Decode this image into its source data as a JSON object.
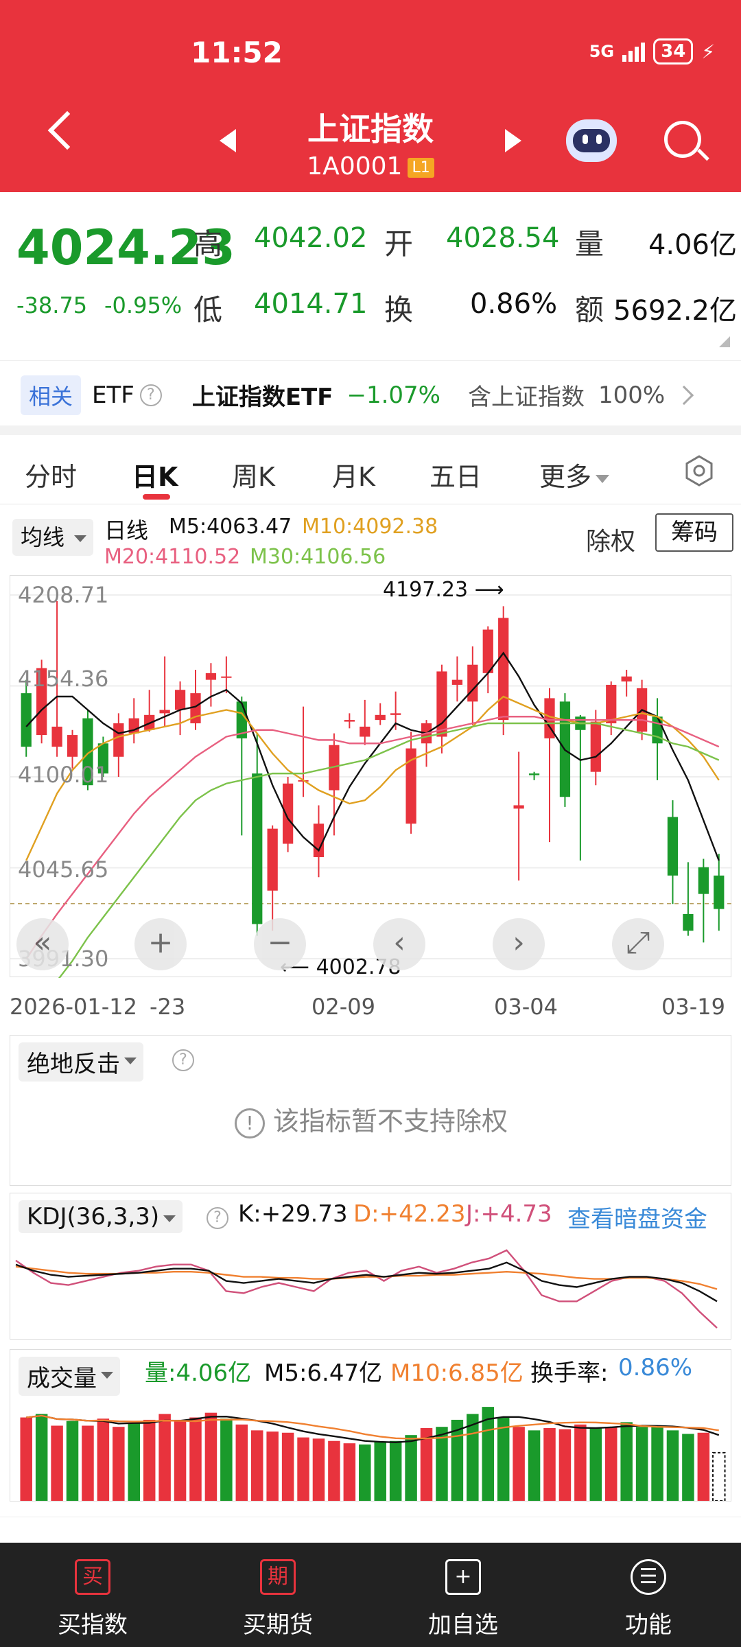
{
  "status": {
    "time": "11:52",
    "network": "5G",
    "battery": "34"
  },
  "header": {
    "title": "上证指数",
    "code": "1A0001",
    "badge": "L1"
  },
  "quote": {
    "price": "4024.23",
    "change": "-38.75",
    "change_pct": "-0.95%",
    "high_label": "高",
    "high": "4042.02",
    "open_label": "开",
    "open": "4028.54",
    "vol_label": "量",
    "vol": "4.06亿",
    "low_label": "低",
    "low": "4014.71",
    "turnover_label": "换",
    "turnover": "0.86%",
    "amount_label": "额",
    "amount": "5692.2亿"
  },
  "etf": {
    "tag": "相关",
    "word": "ETF",
    "name": "上证指数ETF",
    "change": "−1.07%",
    "contain": "含上证指数",
    "pct": "100%"
  },
  "tabs": [
    "分时",
    "日K",
    "周K",
    "月K",
    "五日",
    "更多"
  ],
  "ma": {
    "selector": "均线",
    "type": "日线",
    "m5": "M5:4063.47",
    "m10": "M10:4092.38",
    "m20": "M20:4110.52",
    "m30": "M30:4106.56",
    "chuquan": "除权",
    "chouma": "筹码"
  },
  "colors": {
    "up": "#e8333d",
    "down": "#1a9a2b",
    "m5": "#111111",
    "m10": "#e0a020",
    "m20": "#e86080",
    "m30": "#7cc24a",
    "accent": "#e8333d"
  },
  "chart_data": {
    "type": "candlestick",
    "y_ticks": [
      "4208.71",
      "4154.36",
      "4100.01",
      "4045.65",
      "3991.30"
    ],
    "ylim": [
      3991.3,
      4208.71
    ],
    "x_labels": [
      "2026-01-12",
      "-23",
      "02-09",
      "03-04",
      "03-19"
    ],
    "high_annotation": "4197.23",
    "low_annotation": "4002.78",
    "last_close": 4024.23,
    "candles": [
      [
        4150,
        4118,
        4158,
        4112
      ],
      [
        4125,
        4165,
        4170,
        4120
      ],
      [
        4118,
        4130,
        4205,
        4112
      ],
      [
        4112,
        4125,
        4128,
        4105
      ],
      [
        4135,
        4095,
        4140,
        4092
      ],
      [
        4120,
        4102,
        4124,
        4100
      ],
      [
        4112,
        4132,
        4138,
        4100
      ],
      [
        4126,
        4135,
        4147,
        4120
      ],
      [
        4128,
        4137,
        4152,
        4127
      ],
      [
        4138,
        4140,
        4172,
        4130
      ],
      [
        4140,
        4152,
        4157,
        4125
      ],
      [
        4132,
        4150,
        4164,
        4128
      ],
      [
        4158,
        4162,
        4168,
        4142
      ],
      [
        4160,
        4160,
        4172,
        4150
      ],
      [
        4145,
        4123,
        4148,
        4065
      ],
      [
        4102,
        4012,
        4126,
        4005
      ],
      [
        4032,
        4069,
        4071,
        4008
      ],
      [
        4060,
        4096,
        4100,
        4055
      ],
      [
        4098,
        4098,
        4142,
        4088
      ],
      [
        4052,
        4072,
        4083,
        4040
      ],
      [
        4092,
        4119,
        4126,
        4065
      ],
      [
        4133,
        4134,
        4138,
        4129
      ],
      [
        4124,
        4130,
        4146,
        4119
      ],
      [
        4134,
        4137,
        4144,
        4131
      ],
      [
        4137,
        4138,
        4151,
        4128
      ],
      [
        4072,
        4117,
        4127,
        4066
      ],
      [
        4120,
        4132,
        4134,
        4106
      ],
      [
        4124,
        4163,
        4167,
        4114
      ],
      [
        4155,
        4158,
        4172,
        4145
      ],
      [
        4145,
        4167,
        4178,
        4131
      ],
      [
        4162,
        4188,
        4190,
        4150
      ],
      [
        4134,
        4195,
        4202,
        4125
      ],
      [
        4081,
        4083,
        4115,
        4038
      ],
      [
        4102,
        4101,
        4103,
        4098
      ],
      [
        4123,
        4147,
        4153,
        4061
      ],
      [
        4145,
        4088,
        4150,
        4082
      ],
      [
        4136,
        4128,
        4137,
        4050
      ],
      [
        4103,
        4133,
        4140,
        4095
      ],
      [
        4132,
        4155,
        4157,
        4125
      ],
      [
        4157,
        4160,
        4164,
        4148
      ],
      [
        4127,
        4153,
        4158,
        4122
      ],
      [
        4136,
        4120,
        4147,
        4098
      ],
      [
        4076,
        4041,
        4086,
        4024
      ],
      [
        4018,
        4008,
        4049,
        4005
      ],
      [
        4046,
        4030,
        4051,
        4001
      ],
      [
        4041,
        4021,
        4054,
        4008
      ]
    ],
    "ma_lines": {
      "M5": [
        4130,
        4140,
        4148,
        4148,
        4140,
        4132,
        4126,
        4128,
        4132,
        4136,
        4140,
        4142,
        4148,
        4152,
        4144,
        4120,
        4095,
        4075,
        4064,
        4056,
        4076,
        4094,
        4108,
        4120,
        4132,
        4128,
        4126,
        4132,
        4142,
        4152,
        4162,
        4174,
        4160,
        4143,
        4130,
        4116,
        4110,
        4112,
        4120,
        4130,
        4140,
        4136,
        4116,
        4098,
        4074,
        4050
      ],
      "M10": [
        4050,
        4070,
        4090,
        4104,
        4114,
        4120,
        4124,
        4126,
        4128,
        4130,
        4132,
        4136,
        4138,
        4140,
        4138,
        4126,
        4114,
        4104,
        4098,
        4092,
        4088,
        4084,
        4086,
        4094,
        4104,
        4110,
        4114,
        4118,
        4124,
        4130,
        4140,
        4148,
        4144,
        4140,
        4136,
        4134,
        4132,
        4132,
        4134,
        4136,
        4138,
        4136,
        4130,
        4122,
        4112,
        4098
      ],
      "M20": [
        3991,
        4005,
        4018,
        4030,
        4042,
        4054,
        4066,
        4078,
        4088,
        4096,
        4104,
        4112,
        4118,
        4124,
        4126,
        4128,
        4128,
        4126,
        4124,
        4122,
        4122,
        4120,
        4120,
        4120,
        4122,
        4124,
        4126,
        4128,
        4130,
        4132,
        4134,
        4136,
        4136,
        4136,
        4134,
        4134,
        4134,
        4134,
        4134,
        4134,
        4134,
        4132,
        4130,
        4126,
        4122,
        4118
      ],
      "M30": [
        3950,
        3965,
        3978,
        3990,
        4004,
        4016,
        4028,
        4040,
        4052,
        4064,
        4076,
        4086,
        4092,
        4096,
        4098,
        4100,
        4102,
        4102,
        4102,
        4104,
        4106,
        4108,
        4110,
        4114,
        4118,
        4122,
        4124,
        4126,
        4128,
        4130,
        4132,
        4132,
        4132,
        4132,
        4132,
        4132,
        4132,
        4132,
        4130,
        4128,
        4126,
        4124,
        4120,
        4118,
        4114,
        4110
      ]
    },
    "grid": true
  },
  "indicator1": {
    "selector": "绝地反击",
    "notice": "该指标暂不支持除权"
  },
  "kdj": {
    "selector": "KDJ(36,3,3)",
    "k": "K:+29.73",
    "d": "D:+42.23",
    "j": "J:+4.73",
    "link": "查看暗盘资金",
    "K": [
      66,
      60,
      56,
      54,
      55,
      56,
      57,
      58,
      60,
      62,
      62,
      60,
      50,
      48,
      50,
      52,
      50,
      48,
      52,
      54,
      56,
      54,
      56,
      58,
      57,
      58,
      60,
      62,
      68,
      60,
      50,
      46,
      44,
      48,
      52,
      54,
      54,
      52,
      48,
      40,
      30
    ],
    "D": [
      64,
      62,
      60,
      58,
      57,
      57,
      57,
      58,
      58,
      59,
      59,
      58,
      56,
      54,
      54,
      53,
      53,
      52,
      52,
      53,
      54,
      54,
      55,
      55,
      56,
      56,
      57,
      58,
      59,
      58,
      57,
      55,
      53,
      52,
      52,
      53,
      53,
      52,
      50,
      47,
      42
    ],
    "J": [
      70,
      58,
      48,
      46,
      50,
      54,
      58,
      60,
      64,
      66,
      66,
      60,
      40,
      38,
      44,
      48,
      44,
      40,
      52,
      58,
      60,
      50,
      60,
      64,
      58,
      62,
      68,
      72,
      80,
      60,
      36,
      30,
      30,
      40,
      50,
      54,
      54,
      50,
      38,
      20,
      4
    ]
  },
  "volume": {
    "selector": "成交量",
    "v": "量:4.06亿",
    "m5": "M5:6.47亿",
    "m10": "M10:6.85亿",
    "turnover_label": "换手率:",
    "turnover": "0.86%",
    "bars": [
      7.1,
      7.4,
      6.4,
      6.8,
      6.4,
      7.0,
      6.3,
      6.6,
      6.9,
      7.4,
      6.9,
      7.1,
      7.5,
      7.0,
      6.5,
      6.0,
      5.9,
      5.8,
      5.4,
      5.3,
      5.1,
      4.9,
      4.8,
      5.0,
      5.1,
      5.6,
      6.2,
      6.3,
      6.9,
      7.4,
      8.0,
      7.1,
      6.3,
      6.0,
      6.2,
      6.1,
      6.5,
      6.2,
      6.3,
      6.7,
      6.3,
      6.4,
      6.0,
      5.7,
      5.8,
      4.1
    ],
    "up": [
      1,
      0,
      1,
      0,
      1,
      1,
      1,
      0,
      1,
      1,
      1,
      1,
      1,
      0,
      1,
      1,
      1,
      1,
      1,
      1,
      1,
      1,
      0,
      0,
      0,
      0,
      1,
      0,
      0,
      0,
      0,
      0,
      1,
      0,
      1,
      1,
      1,
      0,
      1,
      0,
      0,
      0,
      0,
      0,
      1,
      0
    ]
  },
  "nav": [
    {
      "label": "买指数",
      "icon": "买"
    },
    {
      "label": "买期货",
      "icon": "期"
    },
    {
      "label": "加自选",
      "icon": "+"
    },
    {
      "label": "功能",
      "icon": "☰"
    }
  ]
}
